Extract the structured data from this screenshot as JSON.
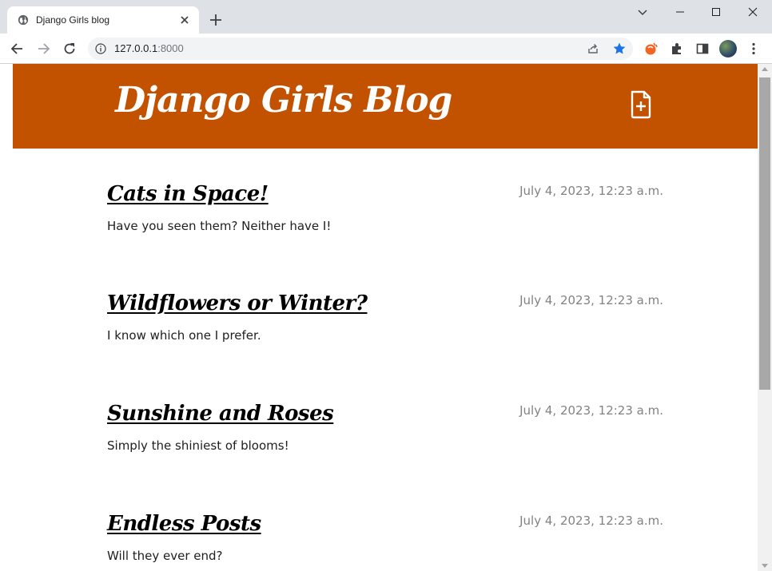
{
  "browser": {
    "tab_title": "Django Girls blog",
    "url_host": "127.0.0.1",
    "url_port": ":8000"
  },
  "site": {
    "title": "Django Girls Blog",
    "header_color": "#c25100"
  },
  "posts": [
    {
      "title": "Cats in Space!",
      "date": "July 4, 2023, 12:23 a.m.",
      "excerpt": "Have you seen them? Neither have I!"
    },
    {
      "title": "Wildflowers or Winter?",
      "date": "July 4, 2023, 12:23 a.m.",
      "excerpt": "I know which one I prefer."
    },
    {
      "title": "Sunshine and Roses",
      "date": "July 4, 2023, 12:23 a.m.",
      "excerpt": "Simply the shiniest of blooms!"
    },
    {
      "title": "Endless Posts",
      "date": "July 4, 2023, 12:23 a.m.",
      "excerpt": "Will they ever end?"
    }
  ],
  "icons": {
    "favicon": "globe-icon",
    "new_post": "file-plus-icon"
  },
  "colors": {
    "accent_star": "#1a73e8",
    "brave_orange": "#f26522"
  }
}
